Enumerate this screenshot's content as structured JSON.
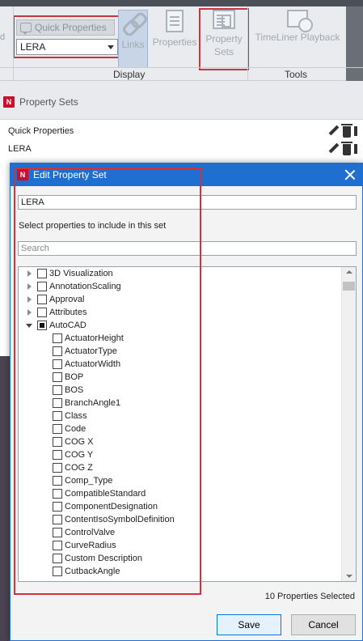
{
  "ribbon": {
    "stub_text": "d",
    "quick_properties_label": "Quick Properties",
    "quick_properties_selected": "LERA",
    "buttons": {
      "links": "Links",
      "properties": "Properties",
      "property_sets_line1": "Property",
      "property_sets_line2": "Sets",
      "timeliner": "TimeLiner Playback"
    },
    "groups": {
      "display": "Display",
      "tools": "Tools"
    },
    "accent_color": "#c8343f"
  },
  "panel": {
    "title": "Property Sets",
    "logo_letter": "N",
    "sets": [
      {
        "name": "Quick Properties"
      },
      {
        "name": "LERA"
      }
    ]
  },
  "dialog": {
    "title": "Edit Property Set",
    "logo_letter": "N",
    "set_name_value": "LERA",
    "instructions": "Select properties to include in this set",
    "search_placeholder": "Search",
    "tree": [
      {
        "label": "3D Visualization",
        "expanded": false,
        "state": "unchecked"
      },
      {
        "label": "AnnotationScaling",
        "expanded": false,
        "state": "unchecked"
      },
      {
        "label": "Approval",
        "expanded": false,
        "state": "unchecked"
      },
      {
        "label": "Attributes",
        "expanded": false,
        "state": "unchecked"
      },
      {
        "label": "AutoCAD",
        "expanded": true,
        "state": "partial",
        "children": [
          "ActuatorHeight",
          "ActuatorType",
          "ActuatorWidth",
          "BOP",
          "BOS",
          "BranchAngle1",
          "Class",
          "Code",
          "COG X",
          "COG Y",
          "COG Z",
          "Comp_Type",
          "CompatibleStandard",
          "ComponentDesignation",
          "ContentIsoSymbolDefinition",
          "ControlValve",
          "CurveRadius",
          "Custom Description",
          "CutbackAngle"
        ]
      }
    ],
    "selected_count": "10 Properties Selected",
    "save_label": "Save",
    "cancel_label": "Cancel",
    "title_bar_color": "#1f6fd1"
  }
}
